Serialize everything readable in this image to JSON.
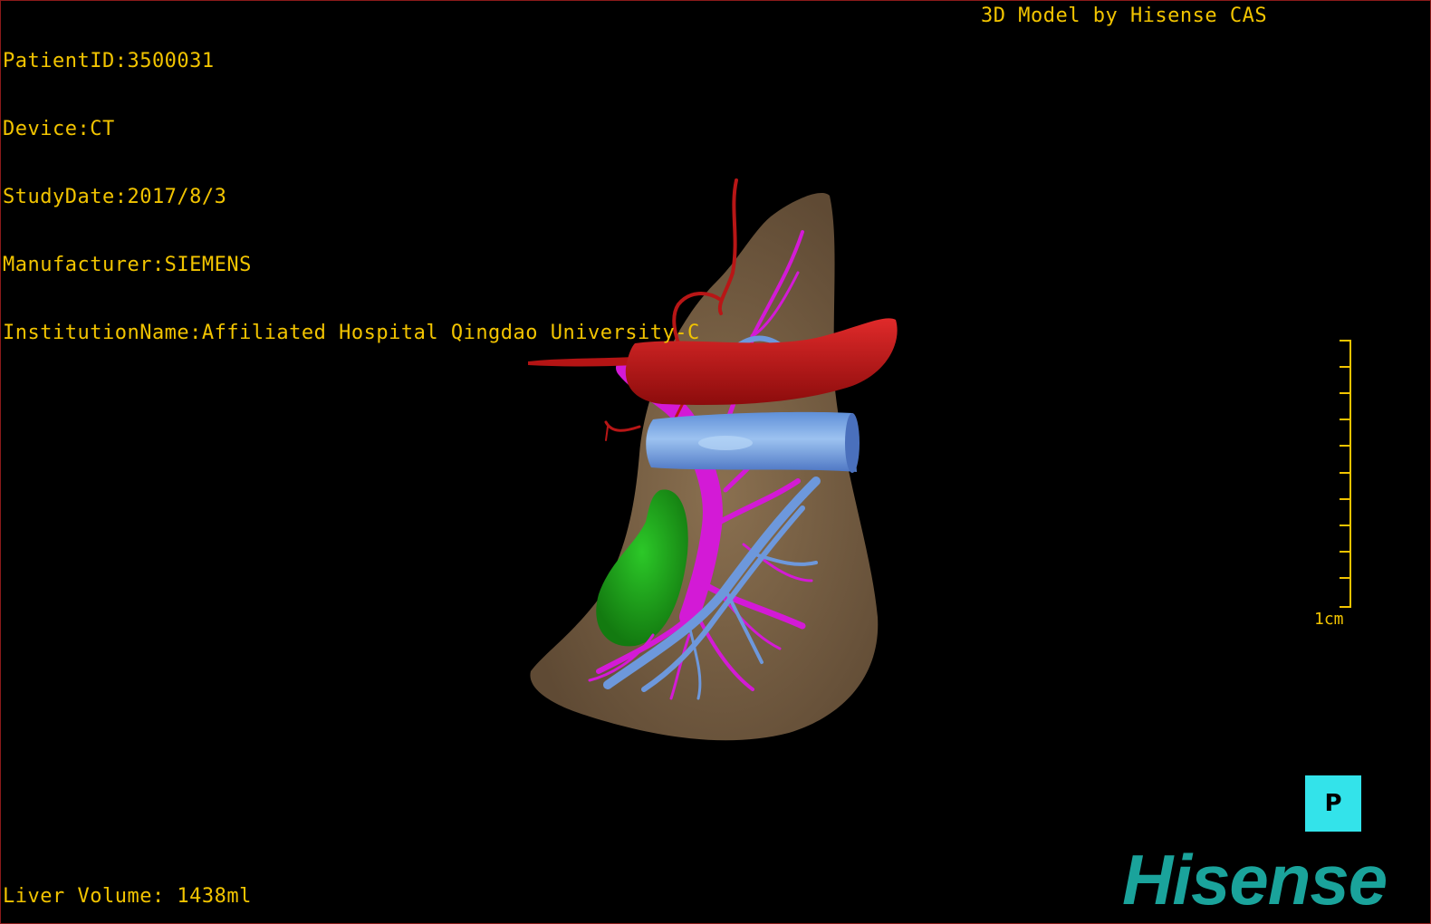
{
  "header": {
    "patient_id": "PatientID:3500031",
    "device": "Device:CT",
    "study_date": "StudyDate:2017/8/3",
    "manufacturer": "Manufacturer:SIEMENS",
    "institution": "InstitutionName:Affiliated Hospital Qingdao University-C",
    "watermark": "3D Model by Hisense CAS"
  },
  "footer": {
    "liver_volume": "Liver Volume: 1438ml",
    "logo": "Hisense"
  },
  "scale": {
    "label": "1cm"
  },
  "orientation": {
    "label": "P"
  },
  "colors": {
    "overlay_text": "#f2c400",
    "liver": "#7d6448",
    "artery": "#c11515",
    "portal_vein": "#d31ad6",
    "hepatic_vein": "#6d98dc",
    "gallbladder": "#1faa1a",
    "orientation_cube": "#33e3ea",
    "logo": "#1aa39b"
  }
}
